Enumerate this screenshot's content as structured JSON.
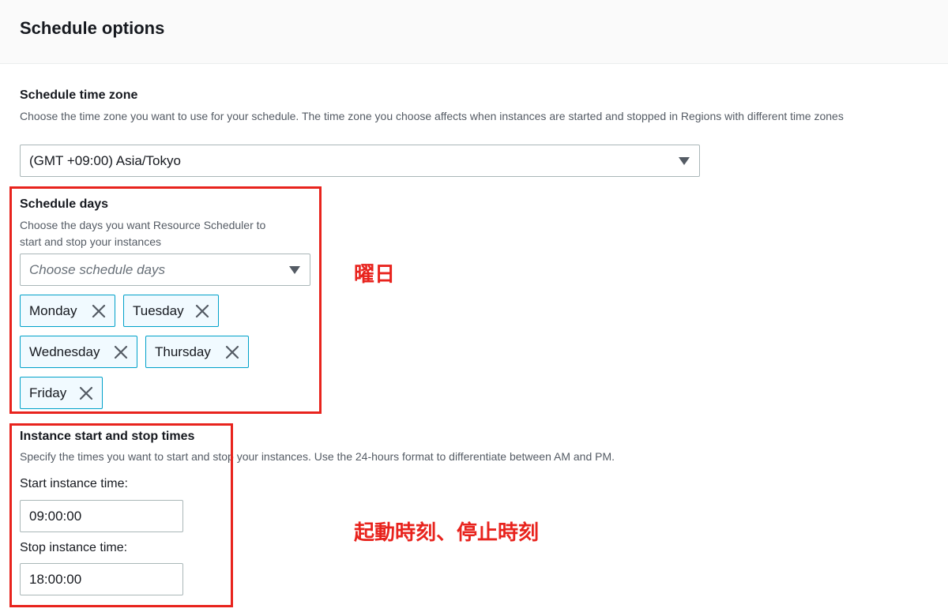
{
  "header": {
    "title": "Schedule options"
  },
  "timezone": {
    "label": "Schedule time zone",
    "description": "Choose the time zone you want to use for your schedule. The time zone you choose affects when instances are started and stopped in Regions with different time zones",
    "selected": "(GMT +09:00) Asia/Tokyo"
  },
  "days": {
    "label": "Schedule days",
    "description_line1": "Choose the days you want Resource Scheduler to",
    "description_line2": "start and stop your instances",
    "placeholder": "Choose schedule days",
    "tokens": [
      "Monday",
      "Tuesday",
      "Wednesday",
      "Thursday",
      "Friday"
    ]
  },
  "times": {
    "label": "Instance start and stop times",
    "description": "Specify the times you want to start and stop your instances. Use the 24-hours format to differentiate between AM and PM.",
    "start_label": "Start instance time:",
    "start_value": "09:00:00",
    "stop_label": "Stop instance time:",
    "stop_value": "18:00:00"
  },
  "annotations": {
    "days_note": "曜日",
    "times_note": "起動時刻、停止時刻",
    "color": "#e8231d"
  },
  "colors": {
    "token_border": "#00a1c9",
    "token_bg": "#f1faff",
    "text": "#16191f",
    "muted": "#545b64"
  }
}
